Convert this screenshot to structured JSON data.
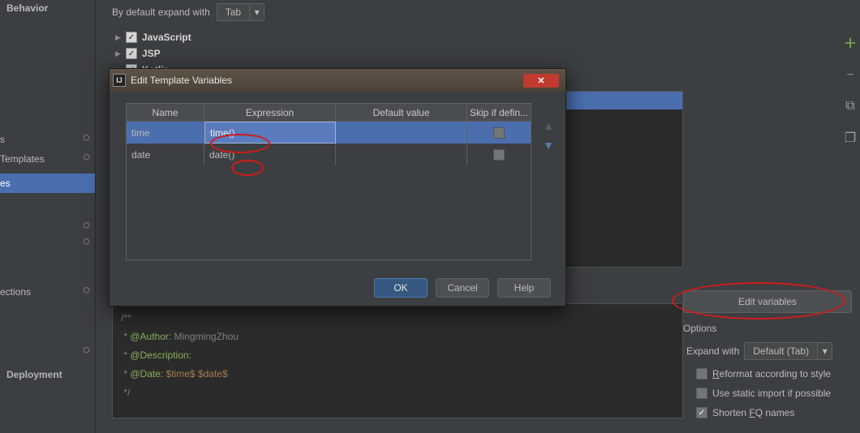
{
  "sidebar": {
    "heading": "Behavior",
    "items": [
      {
        "label": "s"
      },
      {
        "label": " Templates"
      },
      {
        "label": "es",
        "selected": true
      },
      {
        "label": ""
      },
      {
        "label": ""
      },
      {
        "label": "ections"
      },
      {
        "label": ""
      }
    ],
    "deploy_heading": "Deployment"
  },
  "expand": {
    "label": "By default expand with",
    "value": "Tab"
  },
  "tree": [
    {
      "label": "JavaScript",
      "checked": true
    },
    {
      "label": "JSP",
      "checked": true
    },
    {
      "label": "Kotlin",
      "checked": true
    }
  ],
  "editor": {
    "l1a": "/**",
    "l2a": " * ",
    "l2b": "@Author:",
    "l2c": " MingmingZhou",
    "l3a": " * ",
    "l3b": "@Description:",
    "l4a": " * ",
    "l4b": "@Date: ",
    "l4c": "$time$",
    "l4d": " ",
    "l4e": "$date$",
    "l5a": " */"
  },
  "rightpanel": {
    "edit_variables": "Edit variables",
    "options_title": "Options",
    "expand_with_label": "Expand with",
    "expand_with_value": "Default (Tab)",
    "opt_reformat": "eformat according to style",
    "opt_reformat_pre": "R",
    "opt_static": "Use static import if possible",
    "opt_shorten_pre": "Shorten ",
    "opt_shorten_u": "F",
    "opt_shorten_post": "Q names"
  },
  "modal": {
    "title": "Edit Template Variables",
    "columns": {
      "name": "Name",
      "expr": "Expression",
      "def": "Default value",
      "skip": "Skip if defin..."
    },
    "rows": [
      {
        "name": "time",
        "expr": "time()",
        "def": "",
        "skip": false,
        "selected": true
      },
      {
        "name": "date",
        "expr": "date()",
        "def": "",
        "skip": false,
        "selected": false
      }
    ],
    "buttons": {
      "ok": "OK",
      "cancel": "Cancel",
      "help": "Help"
    }
  }
}
